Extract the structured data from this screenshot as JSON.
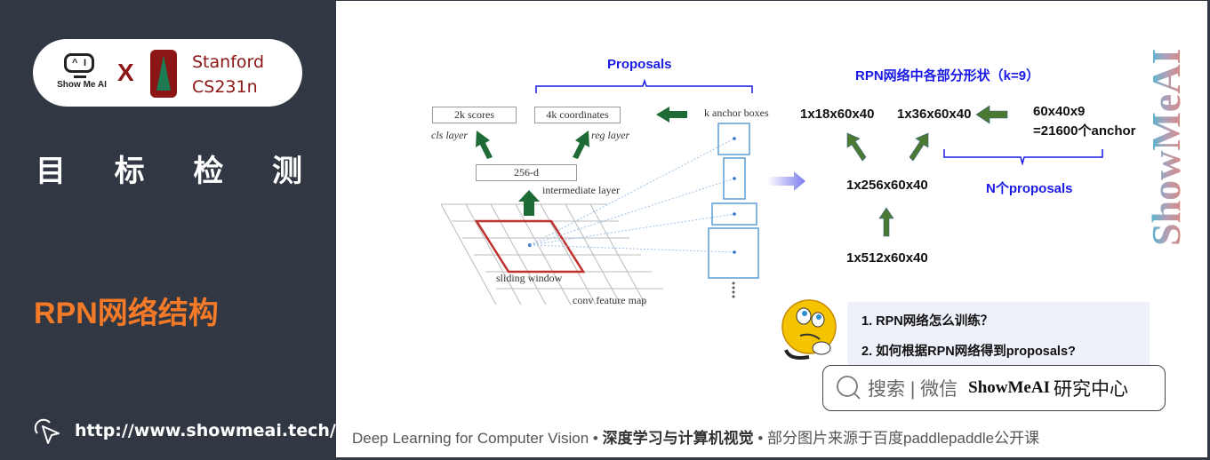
{
  "sidebar": {
    "logo": {
      "showmeai_label": "Show Me AI",
      "cross": "X",
      "stanford_line1": "Stanford",
      "stanford_line2": "CS231n"
    },
    "category_chars": [
      "目",
      "标",
      "检",
      "测"
    ],
    "section_title": "RPN网络结构",
    "site_url": "http://www.showmeai.tech/",
    "accent_color": "#f47a28",
    "bg_color": "#313843"
  },
  "slide": {
    "left_diagram": {
      "proposals_label": "Proposals",
      "scores_box": "2k scores",
      "coords_box": "4k coordinates",
      "cls_layer": "cls layer",
      "reg_layer": "reg layer",
      "intermediate_box": "256-d",
      "intermediate_layer": "intermediate layer",
      "anchor_boxes_label": "k anchor boxes",
      "sliding_window": "sliding window",
      "feature_map": "conv feature map"
    },
    "right_diagram": {
      "title": "RPN网络中各部分形状（k=9）",
      "cls_shape": "1x18x60x40",
      "reg_shape": "1x36x60x40",
      "anchors_line1": "60x40x9",
      "anchors_line2": "=21600个anchor",
      "intermediate_shape": "1x256x60x40",
      "n_proposals": "N个proposals",
      "input_shape": "1x512x60x40"
    },
    "questions": [
      "1.  RPN网络怎么训练？",
      "2.  如何根据RPN网络得到proposals?"
    ],
    "search": {
      "icon": "search-icon",
      "prefix": "搜索 | 微信",
      "brand": "ShowMeAI",
      "suffix": "研究中心"
    },
    "footer": {
      "part1": "Deep Learning for Computer Vision",
      "sep": " • ",
      "part2": "深度学习与计算机视觉",
      "part3": "部分图片来源于百度paddlepaddle公开课"
    },
    "watermark": "ShowMeAI",
    "colors": {
      "arrow_green": "#1f6b36",
      "shape_arrow_green": "#4a7a32",
      "title_blue": "#1a1ae6",
      "window_red": "#c0302e",
      "anchor_blue": "#5b9bd5"
    }
  }
}
